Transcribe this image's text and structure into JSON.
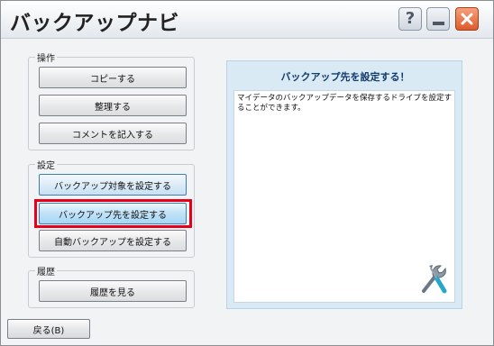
{
  "window": {
    "title": "バックアップナビ",
    "help_glyph": "?"
  },
  "groups": {
    "operations": {
      "label": "操作",
      "buttons": [
        "コピーする",
        "整理する",
        "コメントを記入する"
      ]
    },
    "settings": {
      "label": "設定",
      "buttons": [
        "バックアップ対象を設定する",
        "バックアップ先を設定する",
        "自動バックアップを設定する"
      ]
    },
    "history": {
      "label": "履歴",
      "buttons": [
        "履歴を見る"
      ]
    }
  },
  "info_panel": {
    "title": "バックアップ先を設定する！",
    "description": "マイデータのバックアップデータを保存するドライブを設定することができます。",
    "icon": "tools-icon"
  },
  "footer": {
    "back_label": "戻る(B)"
  },
  "colors": {
    "highlight": "#e8001a",
    "close_button": "#de5a2c",
    "info_panel_bg": "#d9eaf5"
  }
}
